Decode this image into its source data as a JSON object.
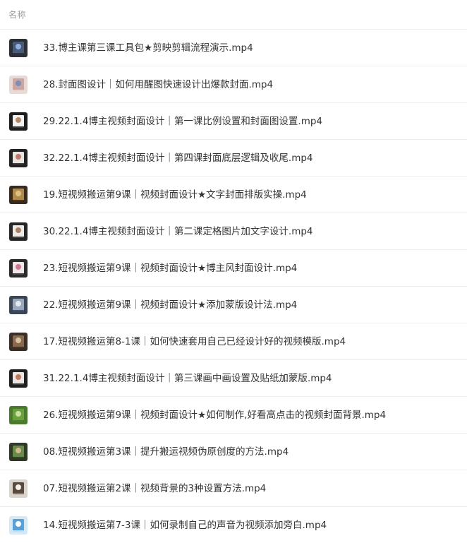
{
  "header": {
    "column_label": "名称"
  },
  "files": [
    {
      "name": "33.博主课第三课工具包★剪映剪辑流程演示.mp4",
      "thumb": {
        "bg": "#2b2f36",
        "mid": "#4a5a7a",
        "accent": "#8fb0e0",
        "icon": "video-thumbnail-icon"
      }
    },
    {
      "name": "28.封面图设计｜如何用醒图快速设计出爆款封面.mp4",
      "thumb": {
        "bg": "#e9d9d6",
        "mid": "#c9a6a2",
        "accent": "#7a8fb8",
        "icon": "video-thumbnail-icon"
      }
    },
    {
      "name": "29.22.1.4博主视频封面设计｜第一课比例设置和封面图设置.mp4",
      "thumb": {
        "bg": "#1e1e1e",
        "mid": "#f2f2f2",
        "accent": "#b58a6a",
        "icon": "video-thumbnail-icon"
      }
    },
    {
      "name": "32.22.1.4博主视频封面设计｜第四课封面底层逻辑及收尾.mp4",
      "thumb": {
        "bg": "#222222",
        "mid": "#e8e4e0",
        "accent": "#c07a6a",
        "icon": "video-thumbnail-icon"
      }
    },
    {
      "name": "19.短视频搬运第9课｜视频封面设计★文字封面排版实操.mp4",
      "thumb": {
        "bg": "#3a2a1e",
        "mid": "#b08a4a",
        "accent": "#e0c080",
        "icon": "video-thumbnail-icon"
      }
    },
    {
      "name": "30.22.1.4博主视频封面设计｜第二课定格图片加文字设计.mp4",
      "thumb": {
        "bg": "#262626",
        "mid": "#efeae6",
        "accent": "#a8806a",
        "icon": "video-thumbnail-icon"
      }
    },
    {
      "name": "23.短视频搬运第9课｜视频封面设计★博主风封面设计.mp4",
      "thumb": {
        "bg": "#2a2a2a",
        "mid": "#f0e6ea",
        "accent": "#d07a90",
        "icon": "video-thumbnail-icon"
      }
    },
    {
      "name": "22.短视频搬运第9课｜视频封面设计★添加蒙版设计法.mp4",
      "thumb": {
        "bg": "#3a4658",
        "mid": "#9aa8bc",
        "accent": "#e4e8ee",
        "icon": "video-thumbnail-icon"
      }
    },
    {
      "name": "17.短视频搬运第8-1课｜如何快速套用自己已经设计好的视频模版.mp4",
      "thumb": {
        "bg": "#3a2e26",
        "mid": "#8a6a4e",
        "accent": "#d8c0a0",
        "icon": "video-thumbnail-icon"
      }
    },
    {
      "name": "31.22.1.4博主视频封面设计｜第三课画中画设置及贴纸加蒙版.mp4",
      "thumb": {
        "bg": "#202020",
        "mid": "#ece6e2",
        "accent": "#c2785e",
        "icon": "video-thumbnail-icon"
      }
    },
    {
      "name": "26.短视频搬运第9课｜视频封面设计★如何制作,好看高点击的视频封面背景.mp4",
      "thumb": {
        "bg": "#4a7a2e",
        "mid": "#6aa040",
        "accent": "#c8e0a0",
        "icon": "video-thumbnail-icon"
      }
    },
    {
      "name": "08.短视频搬运第3课｜提升搬运视频伪原创度的方法.mp4",
      "thumb": {
        "bg": "#2e3a26",
        "mid": "#6a8a4a",
        "accent": "#d0b890",
        "icon": "video-thumbnail-icon"
      }
    },
    {
      "name": "07.短视频搬运第2课｜视频背景的3种设置方法.mp4",
      "thumb": {
        "bg": "#d8d4cc",
        "mid": "#5a4a3e",
        "accent": "#f4f0ea",
        "icon": "video-thumbnail-icon"
      }
    },
    {
      "name": "14.短视频搬运第7-3课｜如何录制自己的声音为视频添加旁白.mp4",
      "thumb": {
        "bg": "#d6e8f4",
        "mid": "#5aa0d8",
        "accent": "#ffffff",
        "icon": "video-thumbnail-icon"
      }
    }
  ]
}
